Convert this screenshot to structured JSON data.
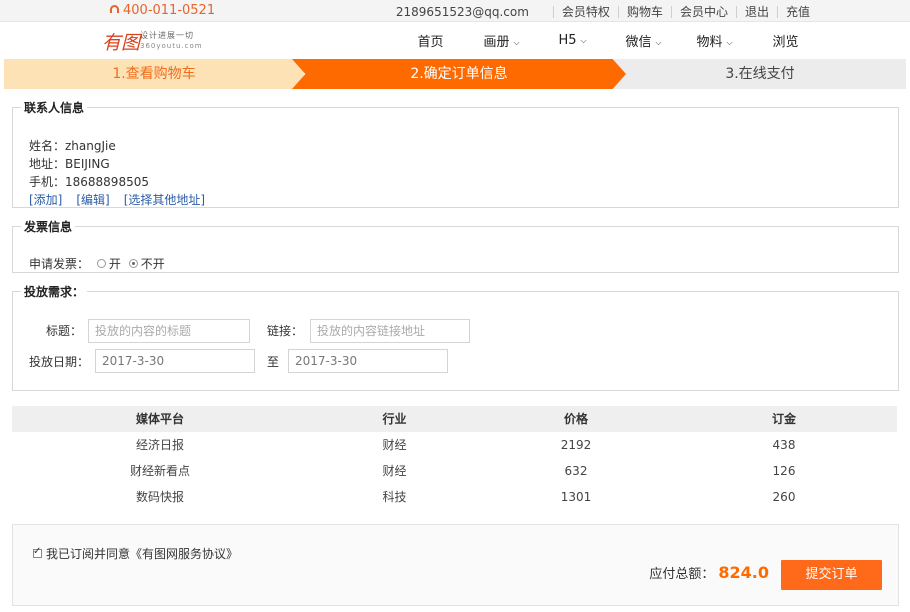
{
  "topbar": {
    "phone": "400-011-0521",
    "email": "2189651523@qq.com",
    "links": [
      "会员特权",
      "购物车",
      "会员中心",
      "退出",
      "充值"
    ]
  },
  "logo": {
    "mark": "有图",
    "slogan": "设计进展一切",
    "domain": "360youtu.com"
  },
  "nav": [
    "首页",
    "画册",
    "H5",
    "微信",
    "物料",
    "浏览"
  ],
  "steps": [
    "1.查看购物车",
    "2.确定订单信息",
    "3.在线支付"
  ],
  "contact": {
    "legend": "联系人信息",
    "name": "姓名：zhangJie",
    "address": "地址：BEIJING",
    "phone": "手机：18688898505",
    "links": [
      "[添加]",
      "[编辑]",
      "[选择其他地址]"
    ]
  },
  "invoice": {
    "legend": "发票信息",
    "label": "申请发票：",
    "options": [
      "开",
      "不开"
    ],
    "selected": "不开"
  },
  "publish": {
    "legend": "投放需求：",
    "title_label": "标题：",
    "title_placeholder": "投放的内容的标题",
    "link_label": "链接：",
    "link_placeholder": "投放的内容链接地址",
    "date_label": "投放日期：",
    "date_from": "2017-3-30",
    "to_label": "至",
    "date_to": "2017-3-30"
  },
  "table": {
    "headers": [
      "媒体平台",
      "行业",
      "价格",
      "订金"
    ],
    "rows": [
      [
        "经济日报",
        "财经",
        "2192",
        "438"
      ],
      [
        "财经新看点",
        "财经",
        "632",
        "126"
      ],
      [
        "数码快报",
        "科技",
        "1301",
        "260"
      ]
    ]
  },
  "footer": {
    "agree": "我已订阅并同意《有图网服务协议》",
    "total_label": "应付总额：",
    "total_value": "824.0",
    "submit": "提交订单"
  },
  "colors": {
    "accent": "#ff6a00",
    "step_done": "#fde2b5",
    "step_next": "#ececec",
    "link": "#2a5da8"
  }
}
